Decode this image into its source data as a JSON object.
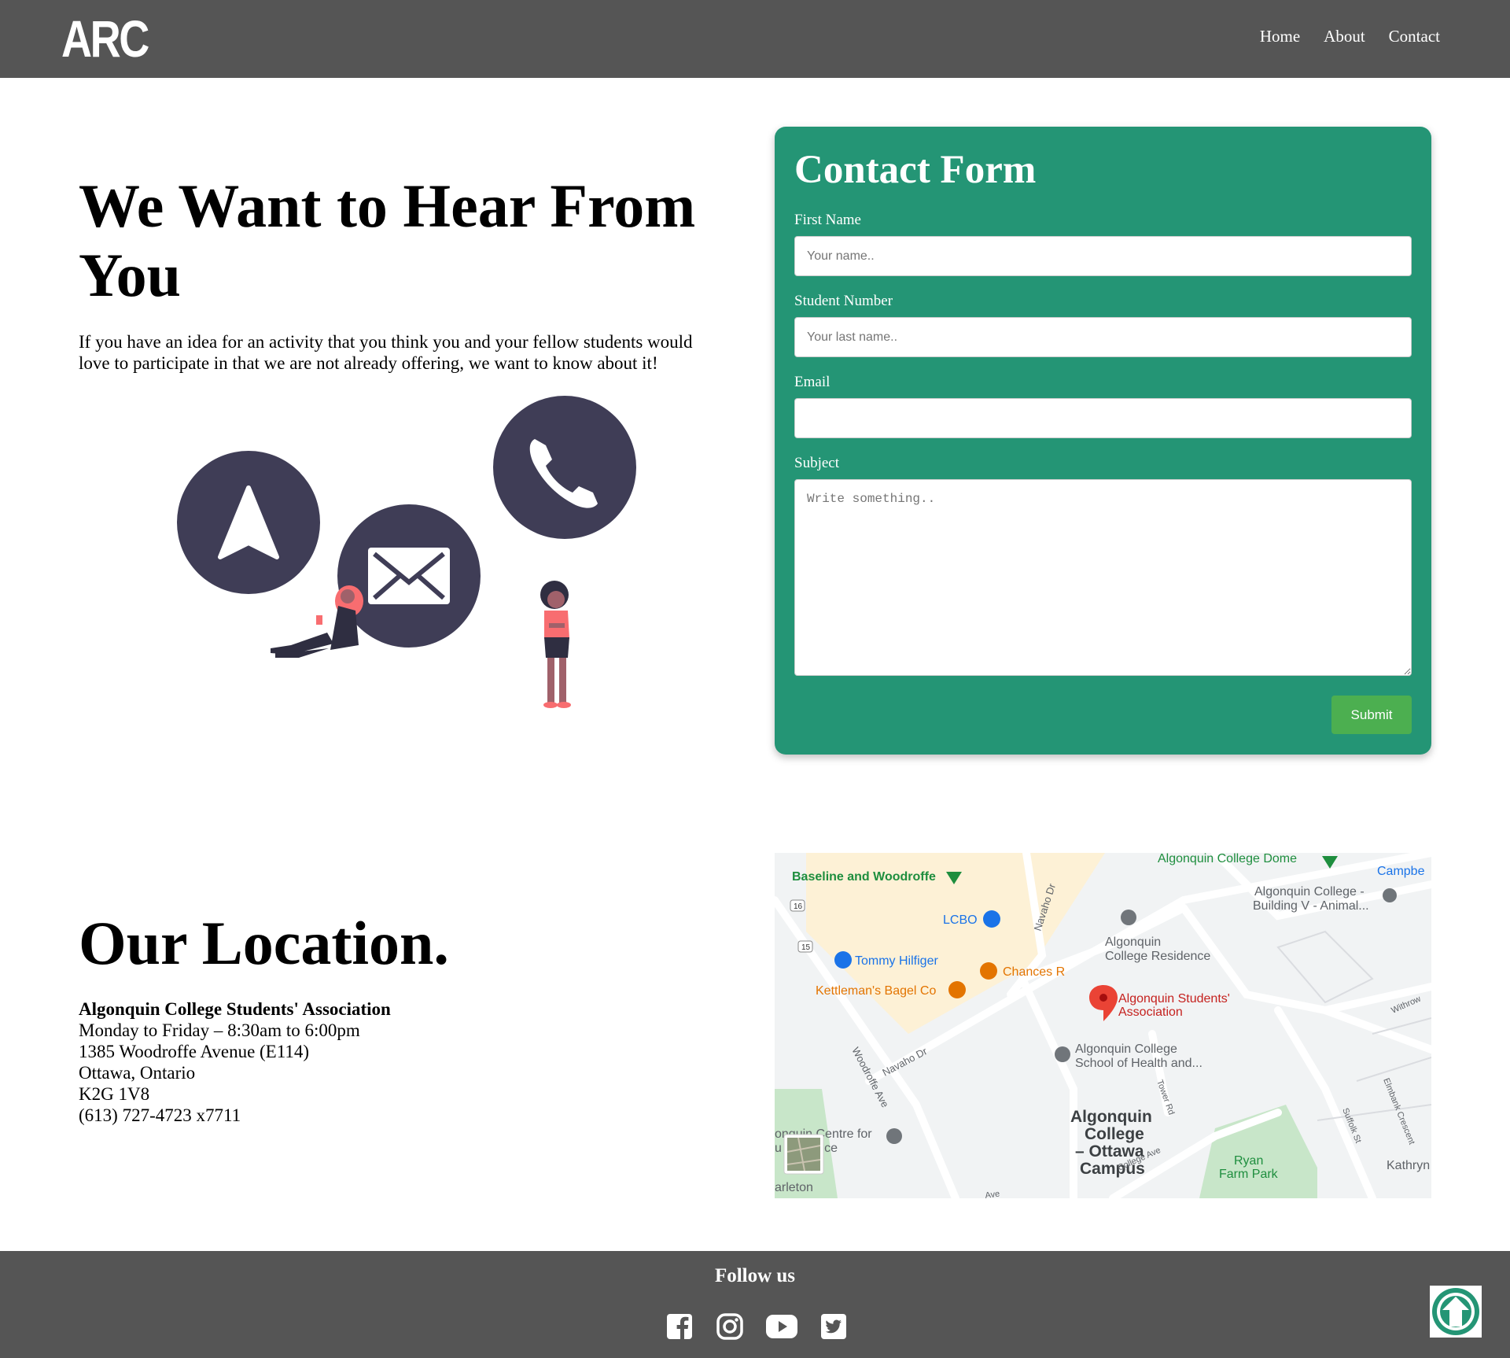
{
  "header": {
    "logo_text": "ARC",
    "nav": [
      {
        "label": "Home"
      },
      {
        "label": "About"
      },
      {
        "label": "Contact"
      }
    ]
  },
  "hero": {
    "title": "We Want to Hear From You",
    "text": "If you have an idea for an activity that you think you and your fellow students would love to participate in that we are not already offering, we want to know about it!"
  },
  "form": {
    "title": "Contact Form",
    "fields": {
      "first_name": {
        "label": "First Name",
        "placeholder": "Your name.."
      },
      "student_number": {
        "label": "Student Number",
        "placeholder": "Your last name.."
      },
      "email": {
        "label": "Email",
        "placeholder": ""
      },
      "subject": {
        "label": "Subject",
        "placeholder": "Write something.."
      }
    },
    "submit_label": "Submit"
  },
  "location": {
    "title": "Our Location.",
    "org": "Algonquin College Students' Association",
    "hours": "Monday to Friday – 8:30am to 6:00pm",
    "street": "1385 Woodroffe Avenue (E114)",
    "city": "Ottawa, Ontario",
    "postal": "K2G 1V8",
    "phone": "(613) 727-4723 x7711"
  },
  "map": {
    "labels": {
      "dome": "Algonquin College Dome",
      "campbell": "Campbe",
      "baseline": "Baseline and Woodroffe",
      "building_v1": "Algonquin College -",
      "building_v2": "Building V - Animal...",
      "lcbo": "LCBO",
      "residence1": "Algonquin",
      "residence2": "College Residence",
      "tommy": "Tommy Hilfiger",
      "chances": "Chances R",
      "kettleman": "Kettleman's Bagel Co",
      "asa1": "Algonquin Students'",
      "asa2": "Association",
      "health1": "Algonquin College",
      "health2": "School of Health and...",
      "campus1": "Algonquin",
      "campus2": "College",
      "campus3": "– Ottawa",
      "campus4": "Campus",
      "ryan1": "Ryan",
      "ryan2": "Farm Park",
      "kathryn": "Kathryn",
      "centre1": "onquin Centre for",
      "centre2": "u    xcellence",
      "carleton": "arleton",
      "navaho1": "Navaho Dr",
      "navaho2": "Navaho Dr",
      "woodroffe": "Woodroffe Ave",
      "tower": "Tower Rd",
      "college_ave": "College Ave",
      "suffolk": "Suffolk St",
      "elmbank": "Elmbank Crescent",
      "withrow": "Withrow",
      "route16": "16",
      "route15": "15",
      "ave": "Ave"
    },
    "colors": {
      "marker": "#ea4335",
      "poi_green": "#1e8e3e",
      "poi_blue": "#1a73e8",
      "poi_orange": "#e37400",
      "park": "#c8e6c9",
      "mall": "#fdf1d6"
    }
  },
  "footer": {
    "follow": "Follow us",
    "socials": [
      {
        "icon": "facebook-icon"
      },
      {
        "icon": "instagram-icon"
      },
      {
        "icon": "youtube-icon"
      },
      {
        "icon": "twitter-icon"
      }
    ],
    "back_to_top_icon": "arrow-up-circle-icon"
  },
  "colors": {
    "header_bg": "#555555",
    "form_bg": "#249575",
    "submit_bg": "#4caf50",
    "illustration_dark": "#3f3d56",
    "accent_coral": "#f86d70"
  }
}
